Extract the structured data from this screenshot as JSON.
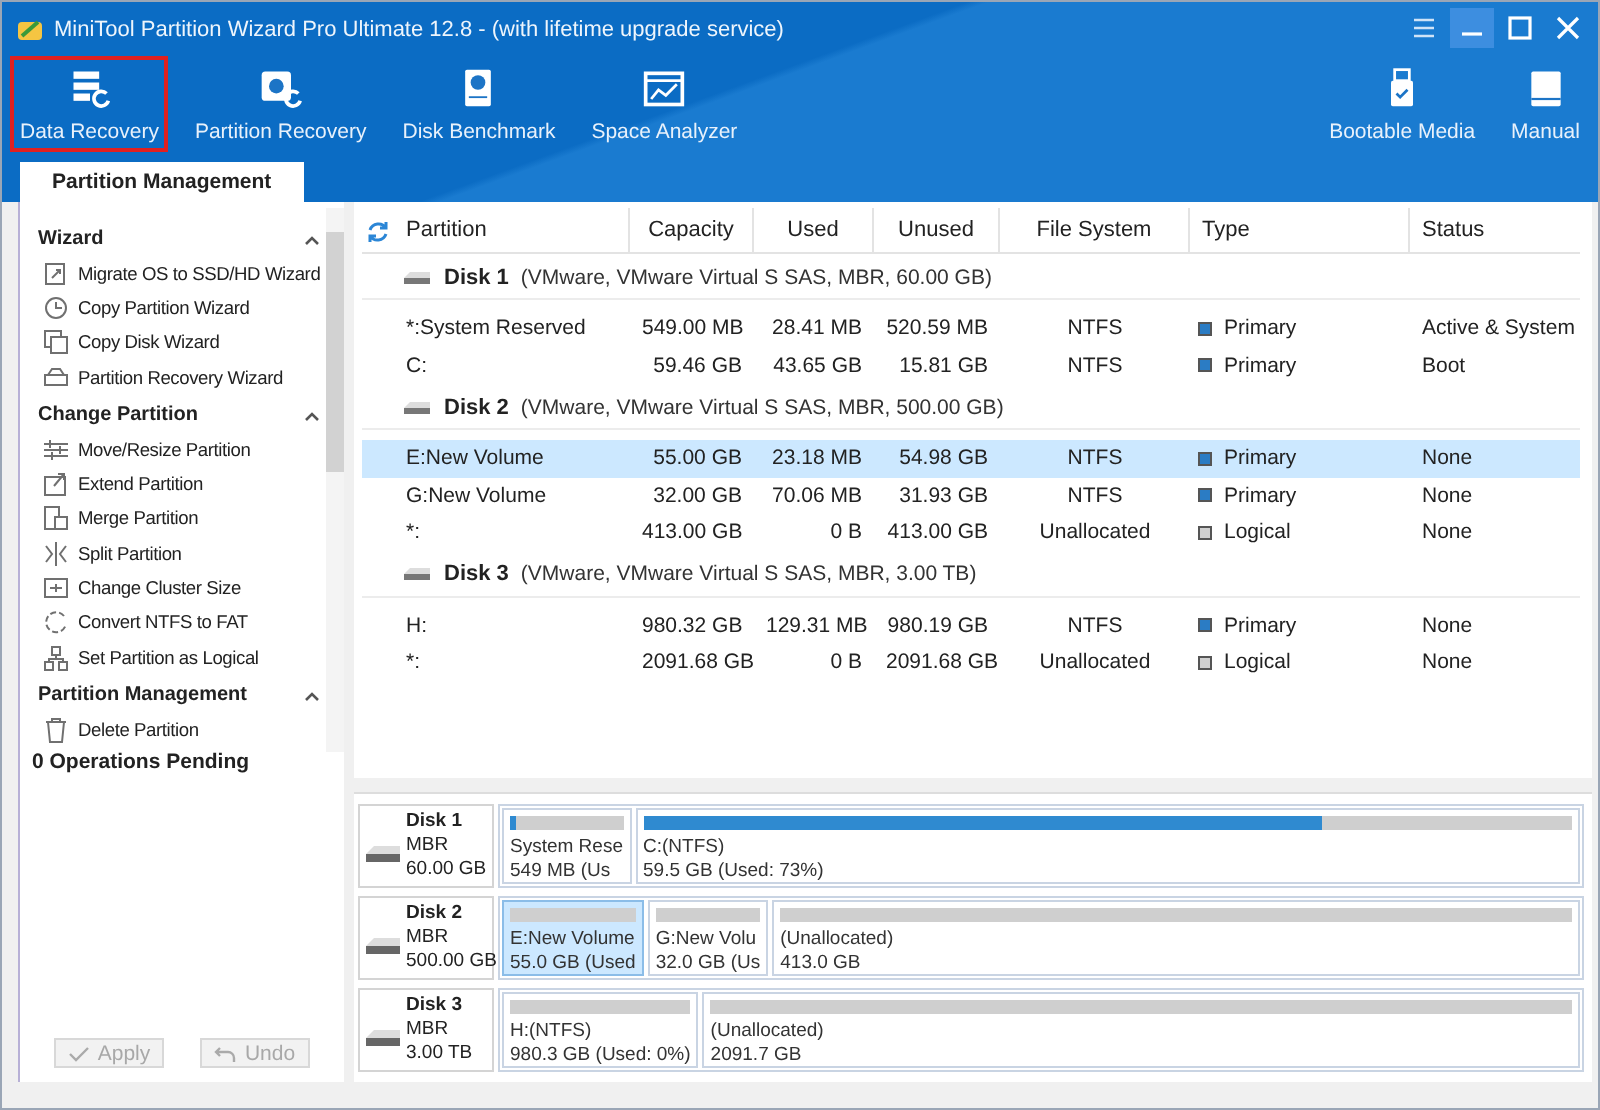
{
  "window": {
    "title": "MiniTool Partition Wizard Pro Ultimate 12.8 - (with lifetime upgrade service)"
  },
  "toolbar": {
    "left": [
      {
        "label": "Data Recovery",
        "highlighted": true
      },
      {
        "label": "Partition Recovery",
        "highlighted": false
      },
      {
        "label": "Disk Benchmark",
        "highlighted": false
      },
      {
        "label": "Space Analyzer",
        "highlighted": false
      }
    ],
    "right": [
      {
        "label": "Bootable Media",
        "highlighted": false
      },
      {
        "label": "Manual",
        "highlighted": false
      }
    ]
  },
  "tabs": [
    {
      "label": "Partition Management",
      "selected": true
    }
  ],
  "sidebar": {
    "groups": [
      {
        "title": "Wizard",
        "expanded": true,
        "items": [
          "Migrate OS to SSD/HD Wizard",
          "Copy Partition Wizard",
          "Copy Disk Wizard",
          "Partition Recovery Wizard"
        ]
      },
      {
        "title": "Change Partition",
        "expanded": true,
        "items": [
          "Move/Resize Partition",
          "Extend Partition",
          "Merge Partition",
          "Split Partition",
          "Change Cluster Size",
          "Convert NTFS to FAT",
          "Set Partition as Logical"
        ]
      },
      {
        "title": "Partition Management",
        "expanded": true,
        "items": [
          "Delete Partition"
        ]
      }
    ],
    "pending": "0 Operations Pending",
    "buttons": [
      {
        "label": "Apply",
        "disabled": true
      },
      {
        "label": "Undo",
        "disabled": true
      }
    ]
  },
  "table": {
    "columns": [
      "Partition",
      "Capacity",
      "Used",
      "Unused",
      "File System",
      "Type",
      "Status"
    ],
    "disks": [
      {
        "name": "Disk 1",
        "details": "(VMware, VMware Virtual S SAS, MBR, 60.00 GB)",
        "partitions": [
          {
            "partition": "*:System Reserved",
            "capacity": "549.00 MB",
            "used": "28.41 MB",
            "unused": "520.59 MB",
            "file_system": "NTFS",
            "type": "Primary",
            "color": "#2b7cc4",
            "status": "Active & System",
            "selected": false
          },
          {
            "partition": "C:",
            "capacity": "59.46 GB",
            "used": "43.65 GB",
            "unused": "15.81 GB",
            "file_system": "NTFS",
            "type": "Primary",
            "color": "#2b7cc4",
            "status": "Boot",
            "selected": false
          }
        ]
      },
      {
        "name": "Disk 2",
        "details": "(VMware, VMware Virtual S SAS, MBR, 500.00 GB)",
        "partitions": [
          {
            "partition": "E:New Volume",
            "capacity": "55.00 GB",
            "used": "23.18 MB",
            "unused": "54.98 GB",
            "file_system": "NTFS",
            "type": "Primary",
            "color": "#2b7cc4",
            "status": "None",
            "selected": true
          },
          {
            "partition": "G:New Volume",
            "capacity": "32.00 GB",
            "used": "70.06 MB",
            "unused": "31.93 GB",
            "file_system": "NTFS",
            "type": "Primary",
            "color": "#2b7cc4",
            "status": "None",
            "selected": false
          },
          {
            "partition": "*:",
            "capacity": "413.00 GB",
            "used": "0 B",
            "unused": "413.00 GB",
            "file_system": "Unallocated",
            "type": "Logical",
            "color": "#d0d0d0",
            "status": "None",
            "selected": false
          }
        ]
      },
      {
        "name": "Disk 3",
        "details": "(VMware, VMware Virtual S SAS, MBR, 3.00 TB)",
        "partitions": [
          {
            "partition": "H:",
            "capacity": "980.32 GB",
            "used": "129.31 MB",
            "unused": "980.19 GB",
            "file_system": "NTFS",
            "type": "Primary",
            "color": "#2b7cc4",
            "status": "None",
            "selected": false
          },
          {
            "partition": "*:",
            "capacity": "2091.68 GB",
            "used": "0 B",
            "unused": "2091.68 GB",
            "file_system": "Unallocated",
            "type": "Logical",
            "color": "#d0d0d0",
            "status": "None",
            "selected": false
          }
        ]
      }
    ]
  },
  "disk_map": [
    {
      "name": "Disk 1",
      "scheme": "MBR",
      "size": "60.00 GB",
      "partitions": [
        {
          "label": "System Rese",
          "detail": "549 MB (Us",
          "level": 0.05,
          "selected": false
        },
        {
          "label": "C:(NTFS)",
          "detail": "59.5 GB (Used: 73%)",
          "level": 0.73,
          "selected": false
        }
      ]
    },
    {
      "name": "Disk 2",
      "scheme": "MBR",
      "size": "500.00 GB",
      "partitions": [
        {
          "label": "E:New Volume",
          "detail": "55.0 GB (Used",
          "level": 0,
          "selected": true
        },
        {
          "label": "G:New Volu",
          "detail": "32.0 GB (Us",
          "level": 0,
          "selected": false
        },
        {
          "label": "(Unallocated)",
          "detail": "413.0 GB",
          "level": 0,
          "selected": false
        }
      ]
    },
    {
      "name": "Disk 3",
      "scheme": "MBR",
      "size": "3.00 TB",
      "partitions": [
        {
          "label": "H:(NTFS)",
          "detail": "980.3 GB (Used: 0%)",
          "level": 0,
          "selected": false
        },
        {
          "label": "(Unallocated)",
          "detail": "2091.7 GB",
          "level": 0,
          "selected": false
        }
      ]
    }
  ]
}
